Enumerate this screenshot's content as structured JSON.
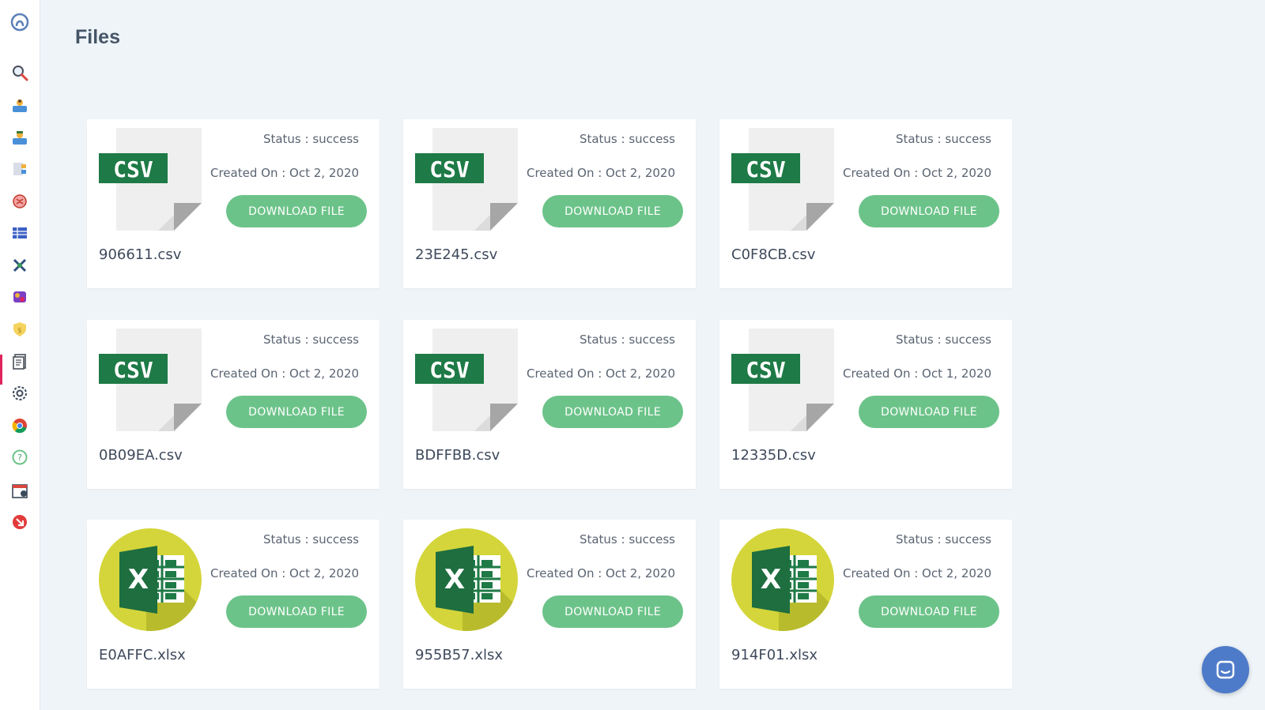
{
  "page": {
    "title": "Files"
  },
  "sidebar": {
    "icons": [
      "logo-icon",
      "search-icon",
      "users-icon",
      "team-icon",
      "contacts-icon",
      "brain-icon",
      "table-icon",
      "satellite-icon",
      "puzzle-icon",
      "shield-icon",
      "files-icon",
      "settings-icon",
      "chrome-icon",
      "help-icon",
      "calendar-icon",
      "logout-icon"
    ],
    "active": "files-icon",
    "accent": "#e0245e"
  },
  "colors": {
    "download_button": "#6cc389",
    "csv_label": "#1e7a46",
    "chat_button": "#4e7bc9"
  },
  "files": [
    {
      "type": "csv",
      "icon": "csv-file-icon",
      "badge": "CSV",
      "status": "Status : success",
      "created": "Created On : Oct 2, 2020",
      "button": "DOWNLOAD FILE",
      "name": "906611.csv"
    },
    {
      "type": "csv",
      "icon": "csv-file-icon",
      "badge": "CSV",
      "status": "Status : success",
      "created": "Created On : Oct 2, 2020",
      "button": "DOWNLOAD FILE",
      "name": "23E245.csv"
    },
    {
      "type": "csv",
      "icon": "csv-file-icon",
      "badge": "CSV",
      "status": "Status : success",
      "created": "Created On : Oct 2, 2020",
      "button": "DOWNLOAD FILE",
      "name": "C0F8CB.csv"
    },
    {
      "type": "csv",
      "icon": "csv-file-icon",
      "badge": "CSV",
      "status": "Status : success",
      "created": "Created On : Oct 2, 2020",
      "button": "DOWNLOAD FILE",
      "name": "0B09EA.csv"
    },
    {
      "type": "csv",
      "icon": "csv-file-icon",
      "badge": "CSV",
      "status": "Status : success",
      "created": "Created On : Oct 2, 2020",
      "button": "DOWNLOAD FILE",
      "name": "BDFFBB.csv"
    },
    {
      "type": "csv",
      "icon": "csv-file-icon",
      "badge": "CSV",
      "status": "Status : success",
      "created": "Created On : Oct 1, 2020",
      "button": "DOWNLOAD FILE",
      "name": "12335D.csv"
    },
    {
      "type": "xlsx",
      "icon": "excel-file-icon",
      "badge": "X",
      "status": "Status : success",
      "created": "Created On : Oct 2, 2020",
      "button": "DOWNLOAD FILE",
      "name": "E0AFFC.xlsx"
    },
    {
      "type": "xlsx",
      "icon": "excel-file-icon",
      "badge": "X",
      "status": "Status : success",
      "created": "Created On : Oct 2, 2020",
      "button": "DOWNLOAD FILE",
      "name": "955B57.xlsx"
    },
    {
      "type": "xlsx",
      "icon": "excel-file-icon",
      "badge": "X",
      "status": "Status : success",
      "created": "Created On : Oct 2, 2020",
      "button": "DOWNLOAD FILE",
      "name": "914F01.xlsx"
    }
  ],
  "chat": {
    "icon": "chat-icon"
  }
}
